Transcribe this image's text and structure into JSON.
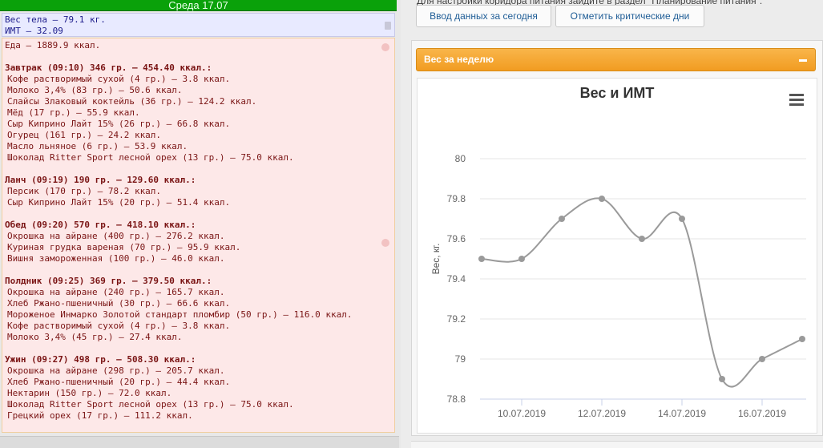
{
  "left": {
    "day_header": "Среда 17.07",
    "stats": {
      "weight": "Вес тела — 79.1 кг.",
      "bmi": "ИМТ — 32.09"
    },
    "food_total": "Еда — 1889.9 ккал.",
    "meals": [
      {
        "title": "Завтрак (09:10) 346 гр. — 454.40 ккал.:",
        "items": [
          "Кофе растворимый сухой (4 гр.) — 3.8 ккал.",
          "Молоко 3,4% (83 гр.) — 50.6 ккал.",
          "Слайсы Злаковый коктейль (36 гр.) — 124.2 ккал.",
          "Мёд (17 гр.) — 55.9 ккал.",
          "Сыр Киприно Лайт 15% (26 гр.) — 66.8 ккал.",
          "Огурец (161 гр.) — 24.2 ккал.",
          "Масло льняное (6 гр.) — 53.9 ккал.",
          "Шоколад Ritter Sport лесной орех (13 гр.) — 75.0 ккал."
        ]
      },
      {
        "title": "Ланч (09:19) 190 гр. — 129.60 ккал.:",
        "items": [
          "Персик (170 гр.) — 78.2 ккал.",
          "Сыр Киприно Лайт 15% (20 гр.) — 51.4 ккал."
        ]
      },
      {
        "title": "Обед (09:20) 570 гр. — 418.10 ккал.:",
        "items": [
          "Окрошка на айране (400 гр.) — 276.2 ккал.",
          "Куриная грудка вареная (70 гр.) — 95.9 ккал.",
          "Вишня замороженная (100 гр.) — 46.0 ккал."
        ]
      },
      {
        "title": "Полдник (09:25) 369 гр. — 379.50 ккал.:",
        "items": [
          "Окрошка на айране (240 гр.) — 165.7 ккал.",
          "Хлеб Ржано-пшеничный (30 гр.) — 66.6 ккал.",
          "Мороженое Инмарко Золотой стандарт пломбир (50 гр.) — 116.0 ккал.",
          "Кофе растворимый сухой (4 гр.) — 3.8 ккал.",
          "Молоко 3,4% (45 гр.) — 27.4 ккал."
        ]
      },
      {
        "title": "Ужин (09:27) 498 гр. — 508.30 ккал.:",
        "items": [
          "Окрошка на айране (298 гр.) — 205.7 ккал.",
          "Хлеб Ржано-пшеничный (20 гр.) — 44.4 ккал.",
          "Нектарин (150 гр.) — 72.0 ккал.",
          "Шоколад Ritter Sport лесной орех (13 гр.) — 75.0 ккал.",
          "Грецкий орех (17 гр.) — 111.2 ккал."
        ]
      }
    ]
  },
  "right": {
    "top_text": "Для настройки коридора питания зайдите в раздел \"Планирование питания\".",
    "btn_input": "Ввод данных за сегодня",
    "btn_critical": "Отметить критические дни",
    "widget_title": "Вес за неделю"
  },
  "colors": {
    "header_green": "#0aa10a",
    "widget_orange": "#f5a733",
    "line": "#9a9a9a"
  },
  "icons": [
    "menu-icon",
    "collapse-icon",
    "hand-icon"
  ],
  "chart_data": {
    "type": "line",
    "title": "Вес и ИМТ",
    "ylabel": "Вес, кг.",
    "ylim": [
      78.8,
      80
    ],
    "yticks": [
      78.8,
      79,
      79.2,
      79.4,
      79.6,
      79.8,
      80
    ],
    "x_ticks": [
      "10.07.2019",
      "12.07.2019",
      "14.07.2019",
      "16.07.2019"
    ],
    "x": [
      "09.07.2019",
      "10.07.2019",
      "11.07.2019",
      "12.07.2019",
      "13.07.2019",
      "14.07.2019",
      "15.07.2019",
      "16.07.2019",
      "17.07.2019"
    ],
    "values": [
      79.5,
      79.5,
      79.7,
      79.8,
      79.6,
      79.7,
      78.9,
      79.0,
      79.1
    ],
    "grid": true
  }
}
